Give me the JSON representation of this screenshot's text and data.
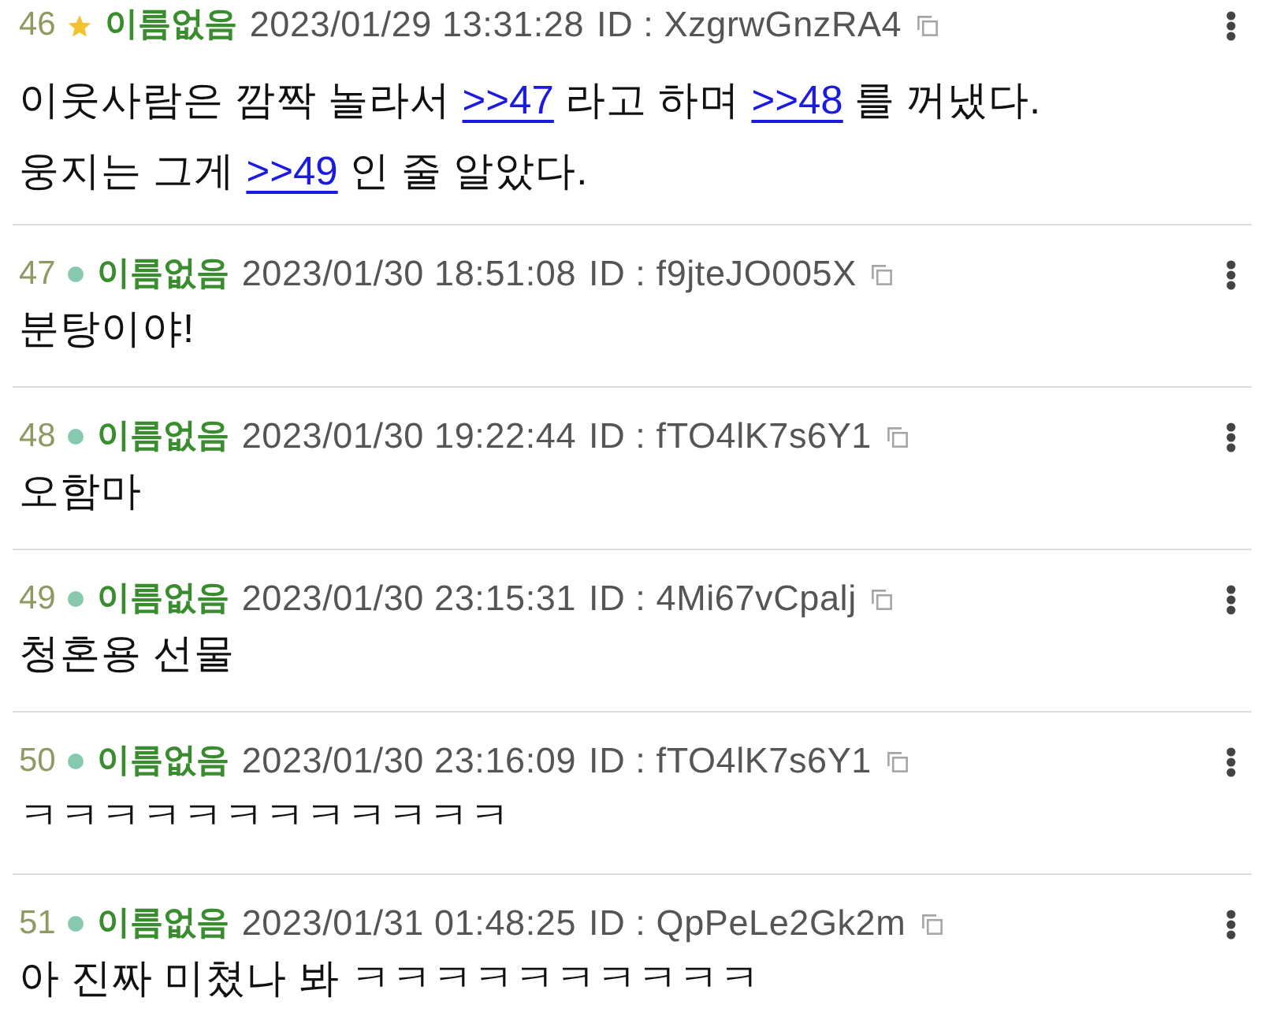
{
  "posts": [
    {
      "number": "46",
      "starred": true,
      "name": "이름없음",
      "datetime": "2023/01/29 13:31:28",
      "id": "ID : XzgrwGnzRA4",
      "lines": [
        [
          {
            "kind": "text",
            "text": "이웃사람은 깜짝 놀라서"
          },
          {
            "kind": "link",
            "text": ">>47"
          },
          {
            "kind": "text",
            "text": "라고 하며"
          },
          {
            "kind": "link",
            "text": ">>48"
          },
          {
            "kind": "text",
            "text": "를 꺼냈다."
          }
        ],
        [
          {
            "kind": "text",
            "text": "웅지는 그게"
          },
          {
            "kind": "link",
            "text": ">>49"
          },
          {
            "kind": "text",
            "text": "인 줄 알았다."
          }
        ]
      ]
    },
    {
      "number": "47",
      "starred": false,
      "name": "이름없음",
      "datetime": "2023/01/30 18:51:08",
      "id": "ID : f9jteJO005X",
      "lines": [
        [
          {
            "kind": "text",
            "text": "분탕이야!"
          }
        ]
      ]
    },
    {
      "number": "48",
      "starred": false,
      "name": "이름없음",
      "datetime": "2023/01/30 19:22:44",
      "id": "ID : fTO4lK7s6Y1",
      "lines": [
        [
          {
            "kind": "text",
            "text": "오함마"
          }
        ]
      ]
    },
    {
      "number": "49",
      "starred": false,
      "name": "이름없음",
      "datetime": "2023/01/30 23:15:31",
      "id": "ID : 4Mi67vCpalj",
      "lines": [
        [
          {
            "kind": "text",
            "text": "청혼용 선물"
          }
        ]
      ]
    },
    {
      "number": "50",
      "starred": false,
      "name": "이름없음",
      "datetime": "2023/01/30 23:16:09",
      "id": "ID : fTO4lK7s6Y1",
      "lines": [
        [
          {
            "kind": "text",
            "text": "ㅋㅋㅋㅋㅋㅋㅋㅋㅋㅋㅋㅋ"
          }
        ]
      ]
    },
    {
      "number": "51",
      "starred": false,
      "name": "이름없음",
      "datetime": "2023/01/31 01:48:25",
      "id": "ID : QpPeLe2Gk2m",
      "lines": [
        [
          {
            "kind": "text",
            "text": "아 진짜 미쳤나 봐 ㅋㅋㅋㅋㅋㅋㅋㅋㅋㅋ"
          }
        ]
      ]
    }
  ]
}
